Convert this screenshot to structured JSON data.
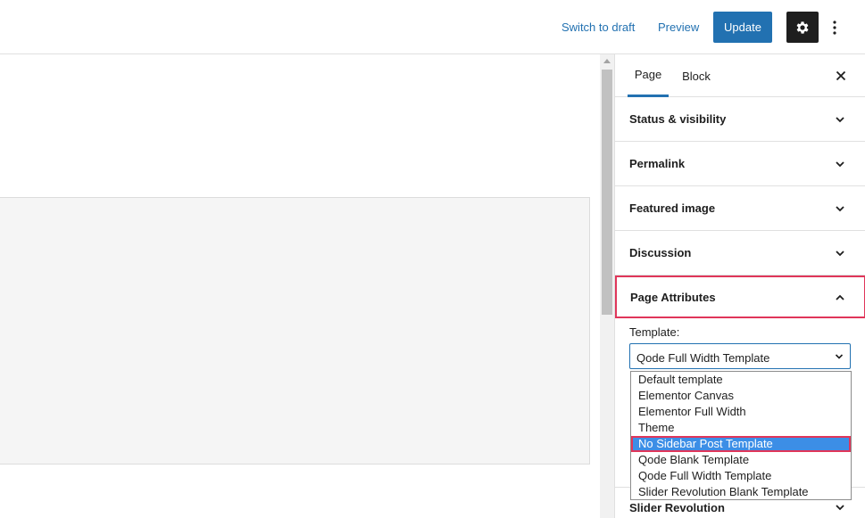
{
  "toolbar": {
    "switch_to_draft": "Switch to draft",
    "preview": "Preview",
    "update": "Update",
    "settings_icon": "gear-icon",
    "more_icon": "vertical-ellipsis-icon"
  },
  "sidebar": {
    "tabs": [
      {
        "label": "Page",
        "active": true
      },
      {
        "label": "Block",
        "active": false
      }
    ],
    "close_icon": "close-icon",
    "panels": [
      {
        "label": "Status & visibility",
        "expanded": false
      },
      {
        "label": "Permalink",
        "expanded": false
      },
      {
        "label": "Featured image",
        "expanded": false
      },
      {
        "label": "Discussion",
        "expanded": false
      },
      {
        "label": "Page Attributes",
        "expanded": true
      }
    ],
    "template_label": "Template:",
    "template_value": "Qode Full Width Template",
    "template_options": [
      "Default template",
      "Elementor Canvas",
      "Elementor Full Width",
      "Theme",
      "No Sidebar Post Template",
      "Qode Blank Template",
      "Qode Full Width Template",
      "Slider Revolution Blank Template"
    ],
    "highlighted_option": "No Sidebar Post Template",
    "slider_revolution": "Slider Revolution"
  },
  "colors": {
    "accent": "#2271b1",
    "highlight": "#e0365a",
    "selected_option_bg": "#3c8ee6"
  }
}
